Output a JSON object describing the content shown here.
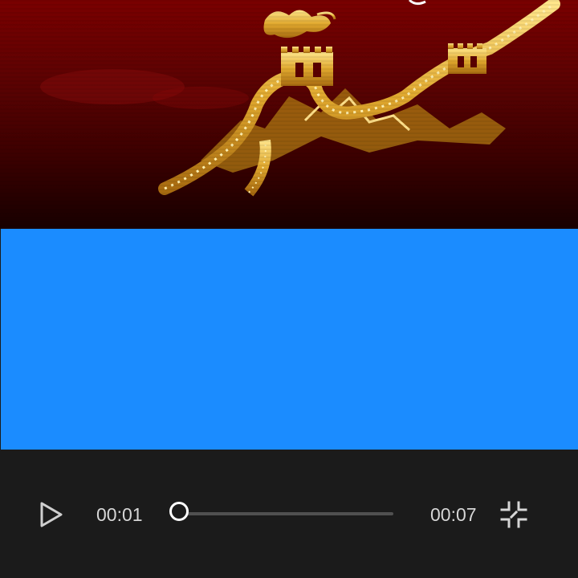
{
  "player": {
    "current_time": "00:01",
    "total_time": "00:07",
    "progress": 0.0,
    "video_placeholder_color": "#1b8cff",
    "background_color": "#1b1b1b",
    "accent_color": "#ffffff",
    "controls": {
      "play_icon": "play-icon",
      "exit_fullscreen_icon": "exit-fullscreen-icon"
    }
  }
}
